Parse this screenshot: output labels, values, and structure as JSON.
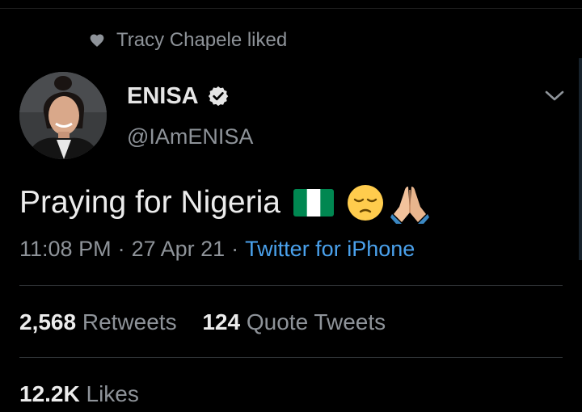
{
  "social_context": {
    "text": "Tracy Chapele liked",
    "icon": "heart-icon"
  },
  "author": {
    "display_name": "ENISA",
    "handle": "@IAmENISA",
    "verified": true
  },
  "tweet": {
    "text": "Praying for Nigeria",
    "emoji": [
      "nigeria-flag-icon",
      "pensive-face-icon",
      "folded-hands-icon"
    ],
    "time": "11:08 PM",
    "separator": "·",
    "date": "27 Apr 21",
    "source": "Twitter for iPhone"
  },
  "stats": {
    "retweets": {
      "count": "2,568",
      "label": "Retweets"
    },
    "quote_tweets": {
      "count": "124",
      "label": "Quote Tweets"
    },
    "likes": {
      "count": "12.2K",
      "label": "Likes"
    }
  },
  "colors": {
    "background": "#000000",
    "primary_text": "#ececec",
    "secondary_text": "#8e9399",
    "link": "#4aa1ec",
    "divider": "#2f3336",
    "flag_green": "#008751"
  }
}
